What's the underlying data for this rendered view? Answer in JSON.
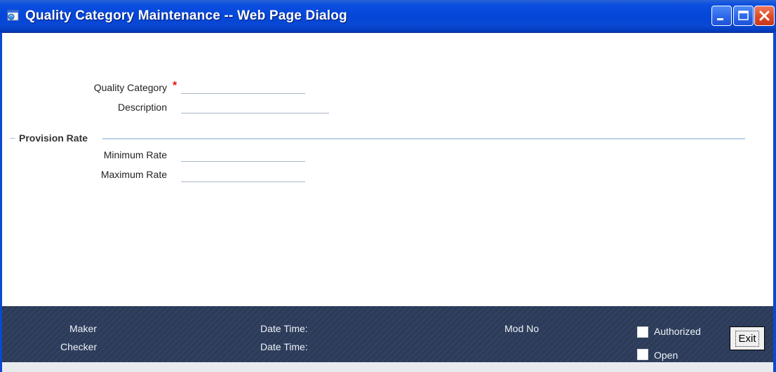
{
  "window": {
    "title": "Quality Category Maintenance -- Web Page Dialog",
    "icons": [
      "app-icon",
      "minimize-icon",
      "maximize-icon",
      "close-icon"
    ]
  },
  "form": {
    "quality_category": {
      "label": "Quality Category",
      "required_marker": "*",
      "value": ""
    },
    "description": {
      "label": "Description",
      "value": ""
    },
    "provision_rate": {
      "title": "Provision Rate",
      "minimum_rate": {
        "label": "Minimum Rate",
        "value": ""
      },
      "maximum_rate": {
        "label": "Maximum Rate",
        "value": ""
      }
    }
  },
  "footer": {
    "maker_label": "Maker",
    "checker_label": "Checker",
    "maker_datetime_label": "Date Time:",
    "checker_datetime_label": "Date Time:",
    "mod_no_label": "Mod No",
    "authorized_label": "Authorized",
    "open_label": "Open",
    "exit_label": "Exit"
  },
  "colors": {
    "titlebar": "#0546d8",
    "footer": "#2b3b59",
    "required": "#d11111",
    "section_line": "#b9d0e6"
  }
}
